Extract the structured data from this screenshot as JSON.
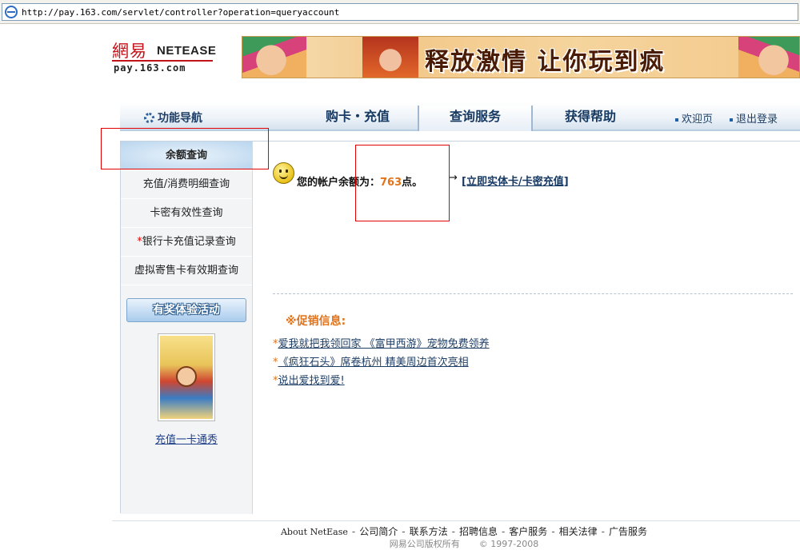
{
  "browser": {
    "url": "http://pay.163.com/servlet/controller?operation=queryaccount"
  },
  "logo": {
    "cn": "網易",
    "en": "NETEASE",
    "sub": "pay.163.com"
  },
  "banner": {
    "text": "释放激情 让你玩到疯"
  },
  "nav": {
    "function_nav": "功能导航",
    "tabs": [
      "购卡・充值",
      "查询服务",
      "获得帮助"
    ],
    "links": [
      "欢迎页",
      "退出登录"
    ]
  },
  "sidebar": {
    "items": [
      "余额查询",
      "充值/消费明细查询",
      "卡密有效性查询",
      "银行卡充值记录查询",
      "虚拟寄售卡有效期查询"
    ],
    "star": "*",
    "promo_button": "有奖体验活动",
    "card_link": "充值一卡通秀"
  },
  "account": {
    "prefix": "您的帐户余额为：",
    "balance": "763",
    "suffix": "点。",
    "arrow": "→",
    "recharge_link": "[立即实体卡/卡密充值]"
  },
  "promo": {
    "title": "※促销信息:",
    "star": "*",
    "items": [
      "爱我就把我领回家 《富甲西游》宠物免费领养",
      "《疯狂石头》席卷杭州 精美周边首次亮相",
      "说出爱找到爱!"
    ]
  },
  "footer": {
    "links": [
      "About NetEase",
      "公司简介",
      "联系方法",
      "招聘信息",
      "客户服务",
      "相关法律",
      "广告服务"
    ],
    "sep": "-",
    "copyright_left": "网易公司版权所有",
    "copyright_right": "© 1997-2008"
  },
  "colors": {
    "accent": "#e0731c",
    "highlight": "#e00000",
    "nav_text": "#173a63"
  }
}
